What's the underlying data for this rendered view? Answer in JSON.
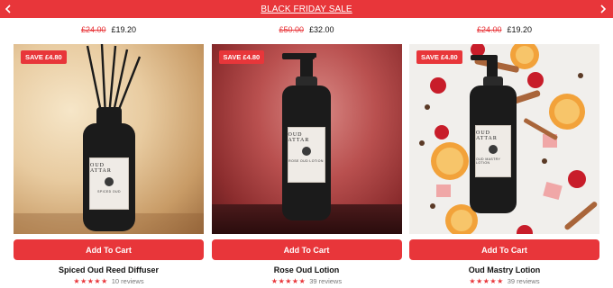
{
  "banner": {
    "text": "BLACK FRIDAY SALE"
  },
  "products": [
    {
      "old_price": "£24.00",
      "new_price": "£19.20",
      "badge": "SAVE £4.80",
      "label_title": "OUD ATTAR",
      "label_sub": "SPICED OUD",
      "cta": "Add To Cart",
      "name": "Spiced Oud Reed Diffuser",
      "stars": "★★★★★",
      "reviews": "10 reviews"
    },
    {
      "old_price": "£50.00",
      "new_price": "£32.00",
      "badge": "SAVE £4.80",
      "label_title": "OUD ATTAR",
      "label_sub": "ROSE OUD LOTION",
      "cta": "Add To Cart",
      "name": "Rose Oud Lotion",
      "stars": "★★★★★",
      "reviews": "39 reviews"
    },
    {
      "old_price": "£24.00",
      "new_price": "£19.20",
      "badge": "SAVE £4.80",
      "label_title": "OUD ATTAR",
      "label_sub": "OUD MASTRY LOTION",
      "cta": "Add To Cart",
      "name": "Oud Mastry Lotion",
      "stars": "★★★★★",
      "reviews": "39 reviews"
    }
  ],
  "colors": {
    "accent": "#e8363a",
    "star": "#e8363a"
  },
  "icons": {
    "prev": "chevron-left-icon",
    "next": "chevron-right-icon",
    "star": "star-icon"
  }
}
